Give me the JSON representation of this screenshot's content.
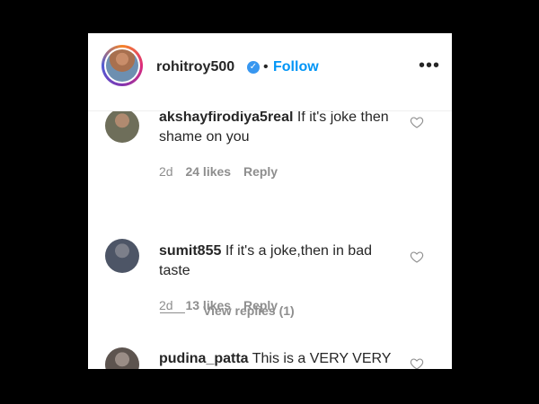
{
  "post_header": {
    "username": "rohitroy500",
    "separator": "•",
    "follow_label": "Follow",
    "more_label": "•••",
    "verified_mark": "✓"
  },
  "comments": [
    {
      "username": "akshayfirodiya5real",
      "text": "If it's joke then shame on you",
      "age": "2d",
      "likes": "24 likes",
      "reply_label": "Reply"
    },
    {
      "username": "sumit855",
      "text": "If it's a joke,then in bad taste",
      "age": "2d",
      "likes": "13 likes",
      "reply_label": "Reply"
    },
    {
      "username": "pudina_patta",
      "text": "This is a VERY VERY"
    }
  ],
  "view_replies": {
    "label": "View replies (1)"
  },
  "colors": {
    "link_blue": "#0095f6",
    "verified_blue": "#3897f0",
    "text_primary": "#262626",
    "text_secondary": "#8e8e8e"
  }
}
